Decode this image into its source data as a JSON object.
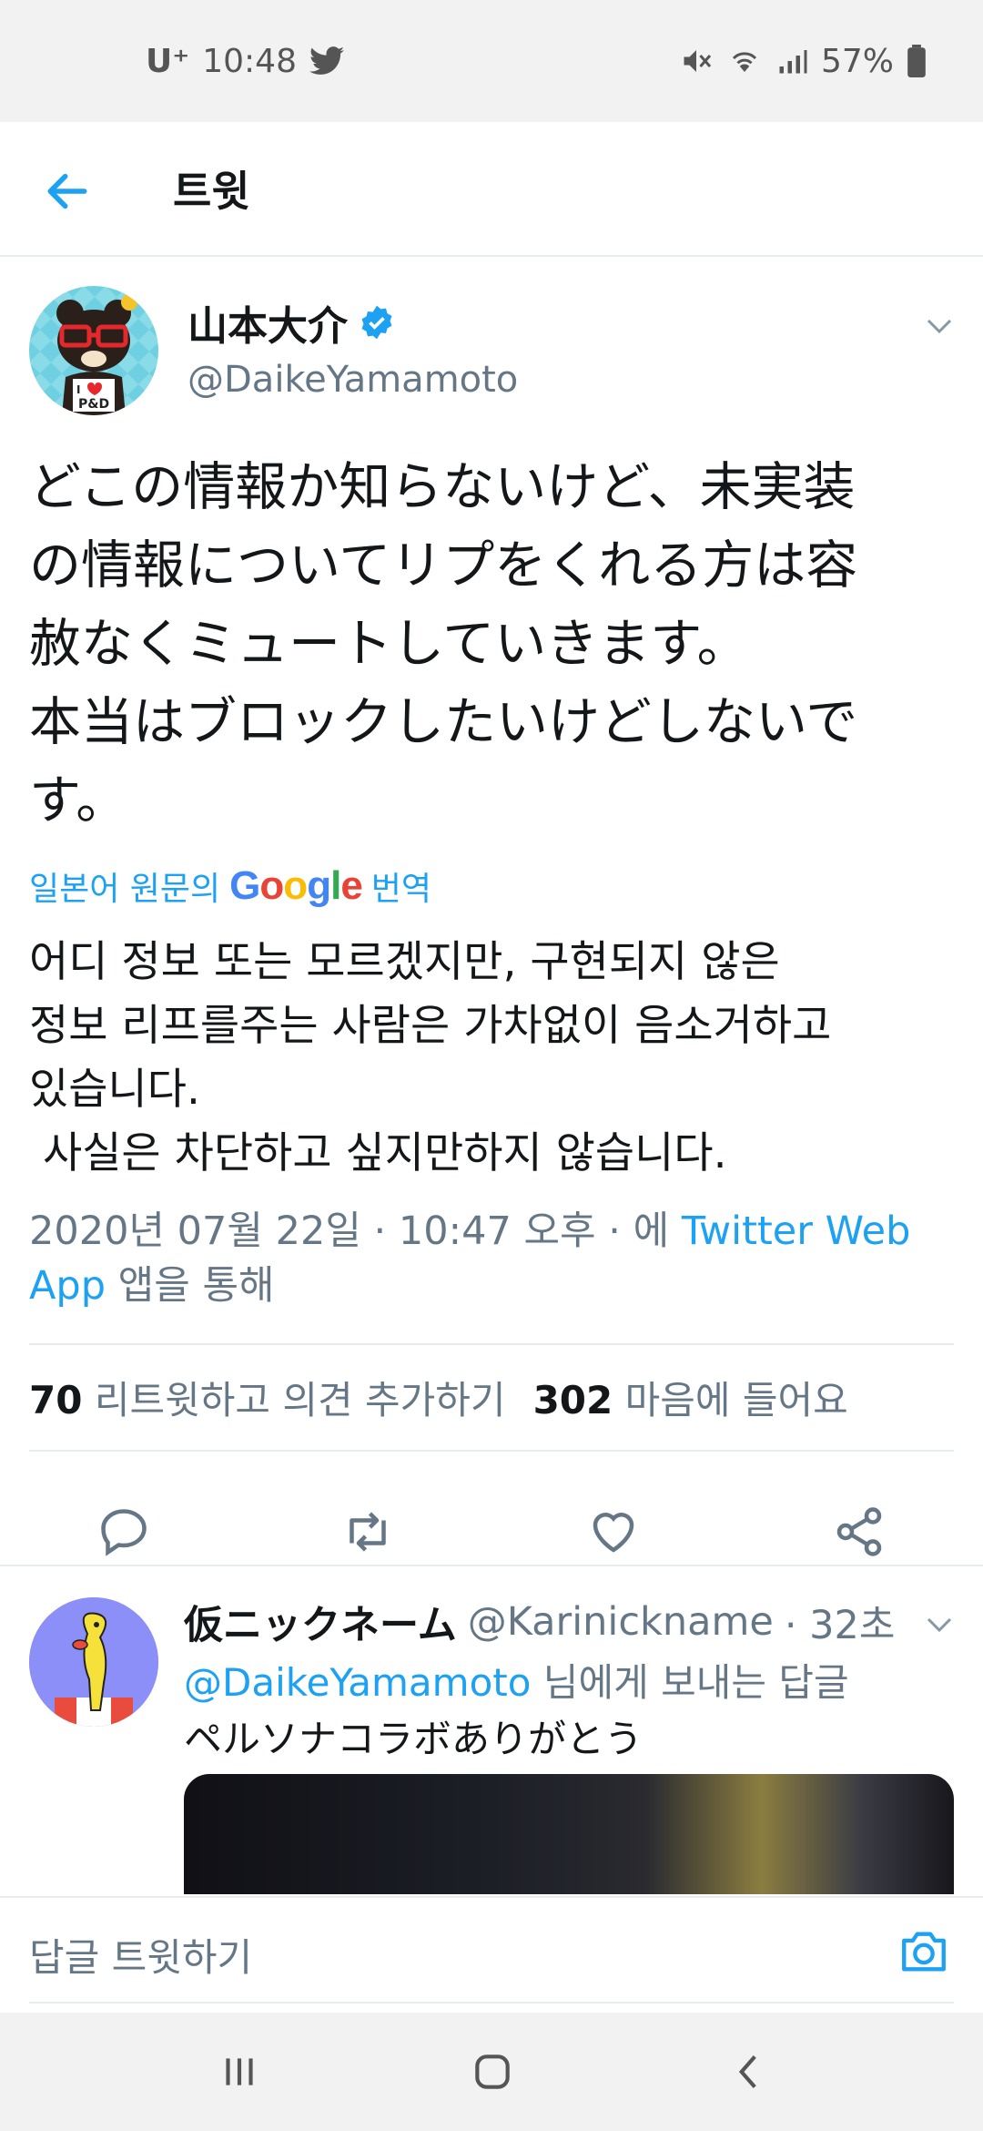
{
  "status_bar": {
    "carrier": "U⁺",
    "time": "10:48",
    "battery": "57%"
  },
  "header": {
    "title": "트윗"
  },
  "tweet": {
    "display_name": "山本大介",
    "handle": "@DaikeYamamoto",
    "text": "どこの情報か知らないけど、未実装\nの情報についてリプをくれる方は容\n赦なくミュートしていきます。\n本当はブロックしたいけどしないで\nす。",
    "translate_prefix": "일본어 원문의",
    "translate_brand": "Google",
    "translate_suffix": "번역",
    "translation": "어디 정보 또는 모르겠지만, 구현되지 않은\n정보 리프를주는 사람은 가차없이 음소거하고\n있습니다.\n 사실은 차단하고 싶지만하지 않습니다.",
    "meta_prefix": "2020년 07월 22일 · 10:47 오후 · 에 ",
    "meta_source": "Twitter Web App",
    "meta_suffix": " 앱을 통해",
    "retweets_count": "70",
    "retweets_label": "리트윗하고 의견 추가하기",
    "likes_count": "302",
    "likes_label": "마음에 들어요"
  },
  "reply": {
    "display_name": "仮ニックネーム",
    "handle": "@Karinickname",
    "time": "· 32초",
    "replying_to_handle": "@DaikeYamamoto",
    "replying_to_suffix": " 님에게 보내는 답글",
    "text": "ペルソナコラボありがとう"
  },
  "compose": {
    "placeholder": "답글 트윗하기"
  },
  "colors": {
    "accent": "#1da1f2",
    "secondary_text": "#657786",
    "divider": "#e6ecf0"
  },
  "icons": [
    "back-arrow-icon",
    "verified-badge-icon",
    "chevron-down-icon",
    "reply-icon",
    "retweet-icon",
    "like-icon",
    "share-icon",
    "camera-icon",
    "recents-icon",
    "home-icon",
    "back-nav-icon"
  ]
}
